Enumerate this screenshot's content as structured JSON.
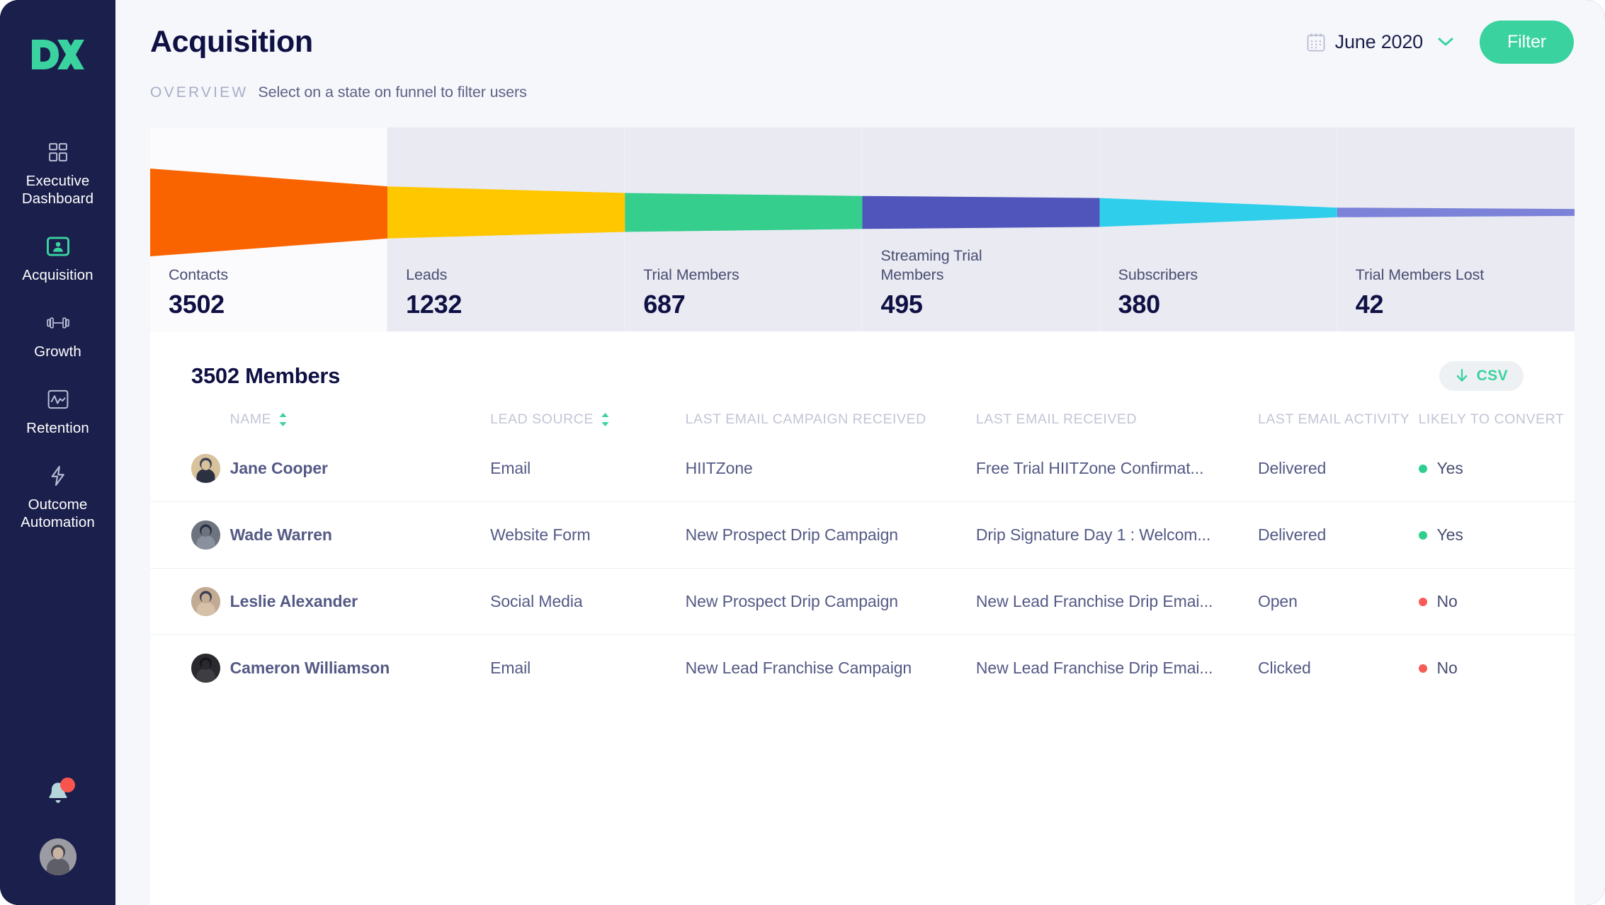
{
  "brand": {
    "logo_text": "DX",
    "logo_color": "#3ad29f"
  },
  "sidebar": {
    "items": [
      {
        "label": "Executive Dashboard",
        "icon": "grid-icon",
        "active": false
      },
      {
        "label": "Acquisition",
        "icon": "user-card-icon",
        "active": true
      },
      {
        "label": "Growth",
        "icon": "dumbbell-icon",
        "active": false
      },
      {
        "label": "Retention",
        "icon": "pulse-chart-icon",
        "active": false
      },
      {
        "label": "Outcome Automation",
        "icon": "lightning-icon",
        "active": false
      }
    ],
    "notification_icon": "bell-icon",
    "notification_badge_color": "#F8554F",
    "avatar_icon": "user-avatar"
  },
  "header": {
    "title": "Acquisition",
    "date_label": "June 2020",
    "date_icon": "calendar-icon",
    "chevron_icon": "chevron-down-icon",
    "filter_label": "Filter",
    "filter_color": "#3ad29f"
  },
  "overview": {
    "kicker": "OVERVIEW",
    "subtitle": "Select on a state on funnel to filter users"
  },
  "chart_data": {
    "type": "funnel",
    "title": "OVERVIEW",
    "categories": [
      "Contacts",
      "Leads",
      "Trial Members",
      "Streaming Trial Members",
      "Subscribers",
      "Trial Members Lost"
    ],
    "values": [
      3502,
      1232,
      687,
      495,
      380,
      42
    ],
    "colors": [
      "#FA6400",
      "#FFC700",
      "#35CE8D",
      "#5055BB",
      "#2FCFEC",
      "#7B82D8"
    ],
    "legend": "none",
    "grid": false,
    "xlabel": "",
    "ylabel": ""
  },
  "table": {
    "count_label": "3502 Members",
    "export_label": "CSV",
    "export_icon": "download-icon",
    "columns": [
      {
        "label": "NAME",
        "sortable": true
      },
      {
        "label": "LEAD SOURCE",
        "sortable": true
      },
      {
        "label": "LAST EMAIL CAMPAIGN RECEIVED",
        "sortable": false
      },
      {
        "label": "LAST EMAIL RECEIVED",
        "sortable": false
      },
      {
        "label": "LAST EMAIL ACTIVITY",
        "sortable": false
      },
      {
        "label": "LIKELY TO CONVERT",
        "sortable": false
      }
    ],
    "rows": [
      {
        "name": "Jane Cooper",
        "lead_source": "Email",
        "last_campaign": "HIITZone",
        "last_email": "Free Trial HIITZone Confirmat...",
        "activity": "Delivered",
        "convert": "Yes",
        "convert_state": "yes"
      },
      {
        "name": "Wade Warren",
        "lead_source": "Website Form",
        "last_campaign": "New Prospect Drip Campaign",
        "last_email": "Drip Signature Day 1 : Welcom...",
        "activity": "Delivered",
        "convert": "Yes",
        "convert_state": "yes"
      },
      {
        "name": "Leslie Alexander",
        "lead_source": "Social Media",
        "last_campaign": "New Prospect Drip Campaign",
        "last_email": "New Lead Franchise Drip Emai...",
        "activity": "Open",
        "convert": "No",
        "convert_state": "no"
      },
      {
        "name": "Cameron Williamson",
        "lead_source": "Email",
        "last_campaign": "New Lead Franchise Campaign",
        "last_email": "New Lead Franchise Drip Emai...",
        "activity": "Clicked",
        "convert": "No",
        "convert_state": "no"
      }
    ]
  }
}
